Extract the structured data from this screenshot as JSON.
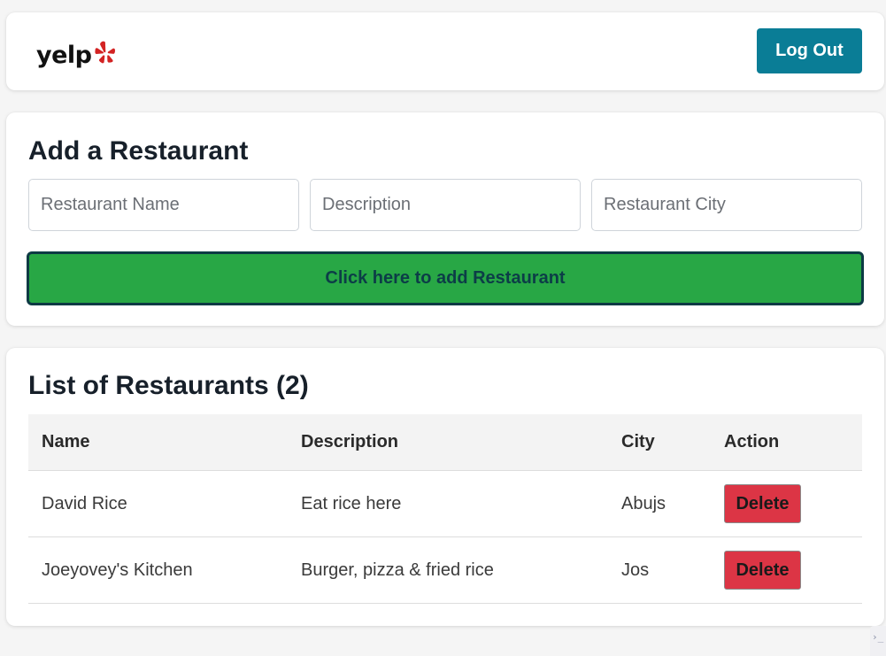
{
  "header": {
    "logo_text": "yelp",
    "logo_icon": "yelp-burst-icon",
    "logout_label": "Log Out",
    "brand_color": "#d32323",
    "logout_color": "#0a7d96"
  },
  "add_section": {
    "title": "Add a Restaurant",
    "name_placeholder": "Restaurant Name",
    "description_placeholder": "Description",
    "city_placeholder": "Restaurant City",
    "submit_label": "Click here to add Restaurant",
    "submit_color": "#28a745"
  },
  "list_section": {
    "title": "List of Restaurants (2)",
    "columns": [
      "Name",
      "Description",
      "City",
      "Action"
    ],
    "rows": [
      {
        "name": "David Rice",
        "description": "Eat rice here",
        "city": "Abujs",
        "action": "Delete"
      },
      {
        "name": "Joeyovey's Kitchen",
        "description": "Burger, pizza & fried rice",
        "city": "Jos",
        "action": "Delete"
      }
    ],
    "delete_color": "#dc3545"
  }
}
